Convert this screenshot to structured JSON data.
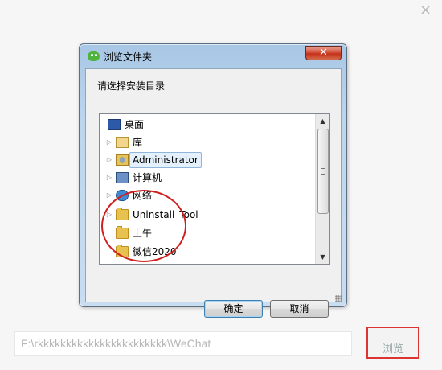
{
  "background_app": {
    "close_icon": "×",
    "path_value": "F:\\rkkkkkkkkkkkkkkkkkkkkkkk\\WeChat",
    "browse_label": "浏览"
  },
  "dialog": {
    "title": "浏览文件夹",
    "close_icon": "✕",
    "prompt": "请选择安装目录",
    "tree": [
      {
        "label": "桌面",
        "icon": "desktop-icon",
        "expander": false
      },
      {
        "label": "库",
        "icon": "library-icon",
        "expander": true
      },
      {
        "label": "Administrator",
        "icon": "user-folder-icon",
        "expander": true,
        "selected": true
      },
      {
        "label": "计算机",
        "icon": "computer-icon",
        "expander": true
      },
      {
        "label": "网络",
        "icon": "network-icon",
        "expander": true
      },
      {
        "label": "Uninstall_Tool",
        "icon": "folder-icon",
        "expander": true
      },
      {
        "label": "上午",
        "icon": "folder-icon",
        "expander": false
      },
      {
        "label": "微信2020",
        "icon": "folder-icon",
        "expander": false
      }
    ],
    "ok_label": "确定",
    "cancel_label": "取消"
  },
  "colors": {
    "annotation": "#d02020",
    "dialog_frame": "#bcd6ee",
    "close_button": "#c3321b"
  }
}
